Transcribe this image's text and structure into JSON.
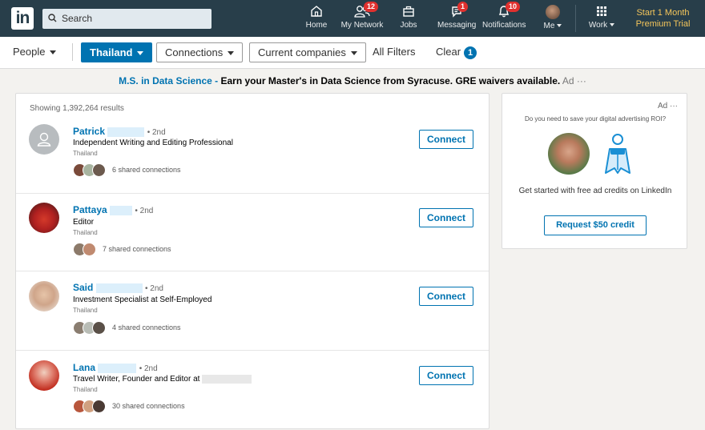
{
  "nav": {
    "logo": "in",
    "search_placeholder": "Search",
    "items": [
      {
        "label": "Home",
        "icon": "home-icon"
      },
      {
        "label": "My Network",
        "icon": "network-icon",
        "badge": "12"
      },
      {
        "label": "Jobs",
        "icon": "briefcase-icon"
      },
      {
        "label": "Messaging",
        "icon": "messaging-icon",
        "badge": "1"
      },
      {
        "label": "Notifications",
        "icon": "bell-icon",
        "badge": "10"
      },
      {
        "label": "Me",
        "icon": "avatar"
      },
      {
        "label": "Work",
        "icon": "grid-icon"
      }
    ],
    "premium_line1": "Start 1 Month",
    "premium_line2": "Premium Trial",
    "colors": {
      "navbar": "#283e4a",
      "accent": "#0073b1",
      "premium": "#f5c65b",
      "badge": "#e0302e"
    }
  },
  "filters": {
    "people": "People",
    "location": "Thailand",
    "connections": "Connections",
    "current_companies": "Current companies",
    "all_filters": "All Filters",
    "clear": "Clear",
    "clear_count": "1"
  },
  "ad_banner": {
    "link": "M.S. in Data Science -",
    "text": "Earn your Master's in Data Science from Syracuse. GRE waivers available.",
    "ad_label": "Ad",
    "more": "···"
  },
  "results": {
    "showing": "Showing 1,392,264 results",
    "connect_label": "Connect",
    "items": [
      {
        "name": "Patrick",
        "degree": "• 2nd",
        "headline": "Independent Writing and Editing Professional",
        "location": "Thailand",
        "shared": "6 shared connections"
      },
      {
        "name": "Pattaya",
        "degree": "• 2nd",
        "headline": "Editor",
        "location": "Thailand",
        "shared": "7 shared connections"
      },
      {
        "name": "Said",
        "degree": "• 2nd",
        "headline": "Investment Specialist at Self-Employed",
        "location": "Thailand",
        "shared": "4 shared connections"
      },
      {
        "name": "Lana",
        "degree": "• 2nd",
        "headline": "Travel Writer, Founder and Editor at",
        "location": "Thailand",
        "shared": "30 shared connections"
      }
    ]
  },
  "side_ad": {
    "ad_label": "Ad",
    "more": "···",
    "question": "Do you need to save your digital advertising ROI?",
    "cta_text": "Get started with free ad credits on LinkedIn",
    "cta_button": "Request $50 credit"
  }
}
